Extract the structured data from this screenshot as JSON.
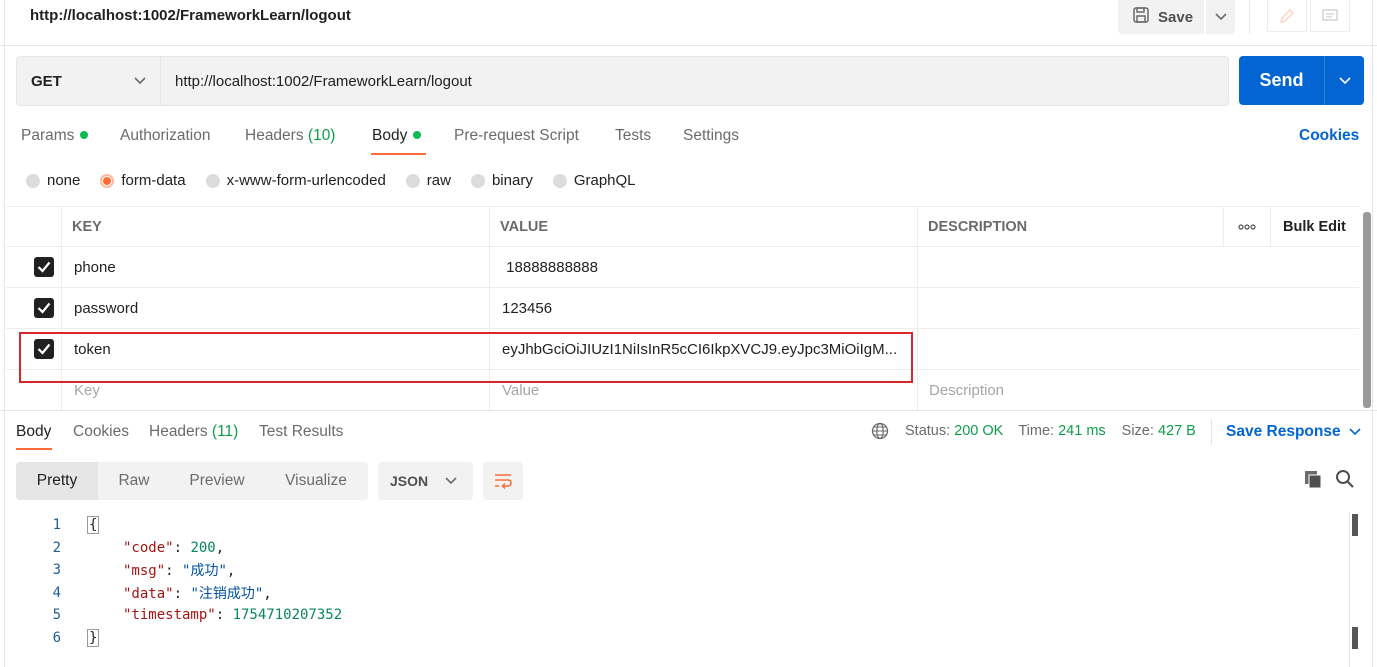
{
  "header": {
    "request_title": "http://localhost:1002/FrameworkLearn/logout",
    "save_label": "Save"
  },
  "request": {
    "method": "GET",
    "url": "http://localhost:1002/FrameworkLearn/logout",
    "send_label": "Send"
  },
  "tabs": {
    "params": "Params",
    "authorization": "Authorization",
    "headers": "Headers",
    "headers_count": "(10)",
    "body": "Body",
    "prerequest": "Pre-request Script",
    "tests": "Tests",
    "settings": "Settings",
    "cookies": "Cookies"
  },
  "body_types": {
    "none": "none",
    "form_data": "form-data",
    "urlencoded": "x-www-form-urlencoded",
    "raw": "raw",
    "binary": "binary",
    "graphql": "GraphQL",
    "selected": "form-data"
  },
  "table": {
    "headers": {
      "key": "KEY",
      "value": "VALUE",
      "description": "DESCRIPTION",
      "more": "ooo",
      "bulk_edit": "Bulk Edit"
    },
    "rows": [
      {
        "key": "phone",
        "value": " 18888888888",
        "description": "",
        "checked": true
      },
      {
        "key": "password",
        "value": "123456",
        "description": "",
        "checked": true
      },
      {
        "key": "token",
        "value": "eyJhbGciOiJIUzI1NiIsInR5cCI6IkpXVCJ9.eyJpc3MiOiIgM...",
        "description": "",
        "checked": true
      }
    ],
    "placeholders": {
      "key": "Key",
      "value": "Value",
      "description": "Description"
    }
  },
  "response": {
    "tabs": {
      "body": "Body",
      "cookies": "Cookies",
      "headers": "Headers",
      "headers_count": "(11)",
      "test_results": "Test Results"
    },
    "status_label": "Status:",
    "status_value": "200 OK",
    "time_label": "Time:",
    "time_value": "241 ms",
    "size_label": "Size:",
    "size_value": "427 B",
    "save_response": "Save Response",
    "views": {
      "pretty": "Pretty",
      "raw": "Raw",
      "preview": "Preview",
      "visualize": "Visualize"
    },
    "format": "JSON",
    "code": {
      "line_numbers": [
        "1",
        "2",
        "3",
        "4",
        "5",
        "6"
      ],
      "open_brace": "{",
      "close_brace": "}",
      "fields": [
        {
          "key": "\"code\"",
          "value": "200",
          "kind": "number"
        },
        {
          "key": "\"msg\"",
          "value": "\"成功\"",
          "kind": "string"
        },
        {
          "key": "\"data\"",
          "value": "\"注销成功\"",
          "kind": "string"
        },
        {
          "key": "\"timestamp\"",
          "value": "1754710207352",
          "kind": "number"
        }
      ]
    }
  },
  "colors": {
    "accent_orange": "#ff6c37",
    "send_blue": "#0265d2",
    "status_green": "#0e9e4a",
    "highlight_red": "#d9262a"
  }
}
